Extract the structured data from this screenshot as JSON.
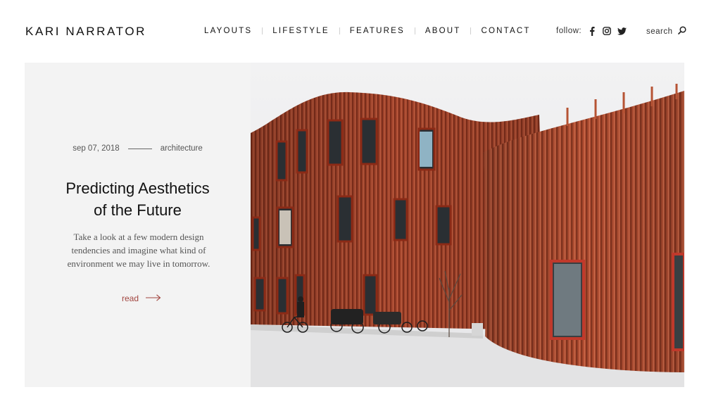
{
  "brand": {
    "name": "KARI NARRATOR"
  },
  "nav": {
    "items": [
      {
        "label": "LAYOUTS"
      },
      {
        "label": "LIFESTYLE"
      },
      {
        "label": "FEATURES"
      },
      {
        "label": "ABOUT"
      },
      {
        "label": "CONTACT"
      }
    ]
  },
  "social": {
    "label": "follow:",
    "icons": [
      "facebook-icon",
      "instagram-icon",
      "twitter-icon"
    ]
  },
  "search": {
    "label": "search",
    "icon": "search-icon"
  },
  "hero": {
    "date": "sep 07, 2018",
    "category": "architecture",
    "title_line1": "Predicting Aesthetics",
    "title_line2": "of the Future",
    "excerpt": "Take a look at a few modern design tendencies and imagine what kind of environment we may live in tomorrow.",
    "read_label": "read",
    "read_icon": "arrow-right-icon"
  },
  "colors": {
    "accent": "#a1453f",
    "panel_bg": "#f3f3f3",
    "facade": "#a2432a"
  }
}
